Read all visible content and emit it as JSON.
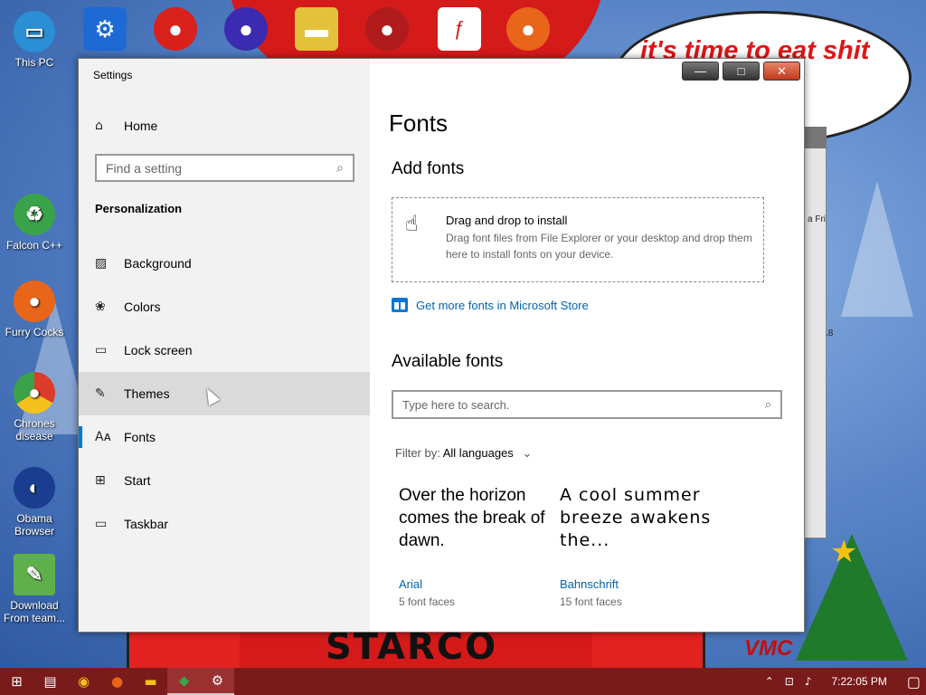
{
  "desktop": {
    "speech_text": "it's time to eat shit chew",
    "shirt_text": "STARCO",
    "corner_text": "VMC",
    "bg_window_text": "a Fri",
    "bg_window_num": ".8",
    "icons_left": [
      {
        "label": "This PC",
        "icon": "monitor-icon",
        "color": "#2a8fd4"
      },
      {
        "label": "Falcon C++",
        "icon": "recycle-icon",
        "color": "#3aa34a"
      },
      {
        "label": "Furry Cocks",
        "icon": "firefox-icon",
        "color": "#e8651a"
      },
      {
        "label": "Chrones disease",
        "icon": "chrome-icon",
        "color": "#dd3b2b"
      },
      {
        "label": "Obama Browser",
        "icon": "obama-icon",
        "color": "#1a3d8f"
      },
      {
        "label": "Download From team...",
        "icon": "notepad-icon",
        "color": "#5fb04a"
      }
    ],
    "icons_top": [
      {
        "icon": "gear-icon",
        "color": "#1e6ad4"
      },
      {
        "icon": "red-creature-icon",
        "color": "#d8211b"
      },
      {
        "icon": "ornament-icon",
        "color": "#3b2bb0"
      },
      {
        "icon": "sandwich-icon",
        "color": "#e3c23a"
      },
      {
        "icon": "bomb-icon",
        "color": "#b01c1c"
      },
      {
        "icon": "flash-swf-icon",
        "color": "#c91c1c"
      },
      {
        "icon": "firefox-icon",
        "color": "#e8651a"
      }
    ]
  },
  "window": {
    "title": "Settings",
    "controls": {
      "minimize": "—",
      "maximize": "□",
      "close": "✕"
    }
  },
  "sidebar": {
    "home_label": "Home",
    "search_placeholder": "Find a setting",
    "section": "Personalization",
    "items": [
      {
        "label": "Background",
        "icon": "picture-icon",
        "glyph": "▨"
      },
      {
        "label": "Colors",
        "icon": "palette-icon",
        "glyph": "❀"
      },
      {
        "label": "Lock screen",
        "icon": "lock-screen-icon",
        "glyph": "▭"
      },
      {
        "label": "Themes",
        "icon": "brush-icon",
        "glyph": "✎"
      },
      {
        "label": "Fonts",
        "icon": "fonts-icon",
        "glyph": "Aᴀ"
      },
      {
        "label": "Start",
        "icon": "start-icon",
        "glyph": "⊞"
      },
      {
        "label": "Taskbar",
        "icon": "taskbar-icon",
        "glyph": "▭"
      }
    ]
  },
  "content": {
    "title": "Fonts",
    "add_heading": "Add fonts",
    "drop_title": "Drag and drop to install",
    "drop_desc": "Drag font files from File Explorer or your desktop and drop them here to install fonts on your device.",
    "store_link": "Get more fonts in Microsoft Store",
    "available_heading": "Available fonts",
    "font_search_placeholder": "Type here to search.",
    "filter_label": "Filter by:",
    "filter_value": "All languages",
    "cards": [
      {
        "sample": "Over the horizon comes the break of dawn.",
        "name": "Arial",
        "faces": "5 font faces"
      },
      {
        "sample": "A cool summer breeze awakens the...",
        "name": "Bahnschrift",
        "faces": "15 font faces"
      }
    ]
  },
  "taskbar": {
    "clock": "7:22:05 PM",
    "apps": [
      "start-icon",
      "task-view-icon",
      "chrome-icon",
      "firefox-icon",
      "file-explorer-icon",
      "app-icon",
      "settings-icon"
    ]
  }
}
